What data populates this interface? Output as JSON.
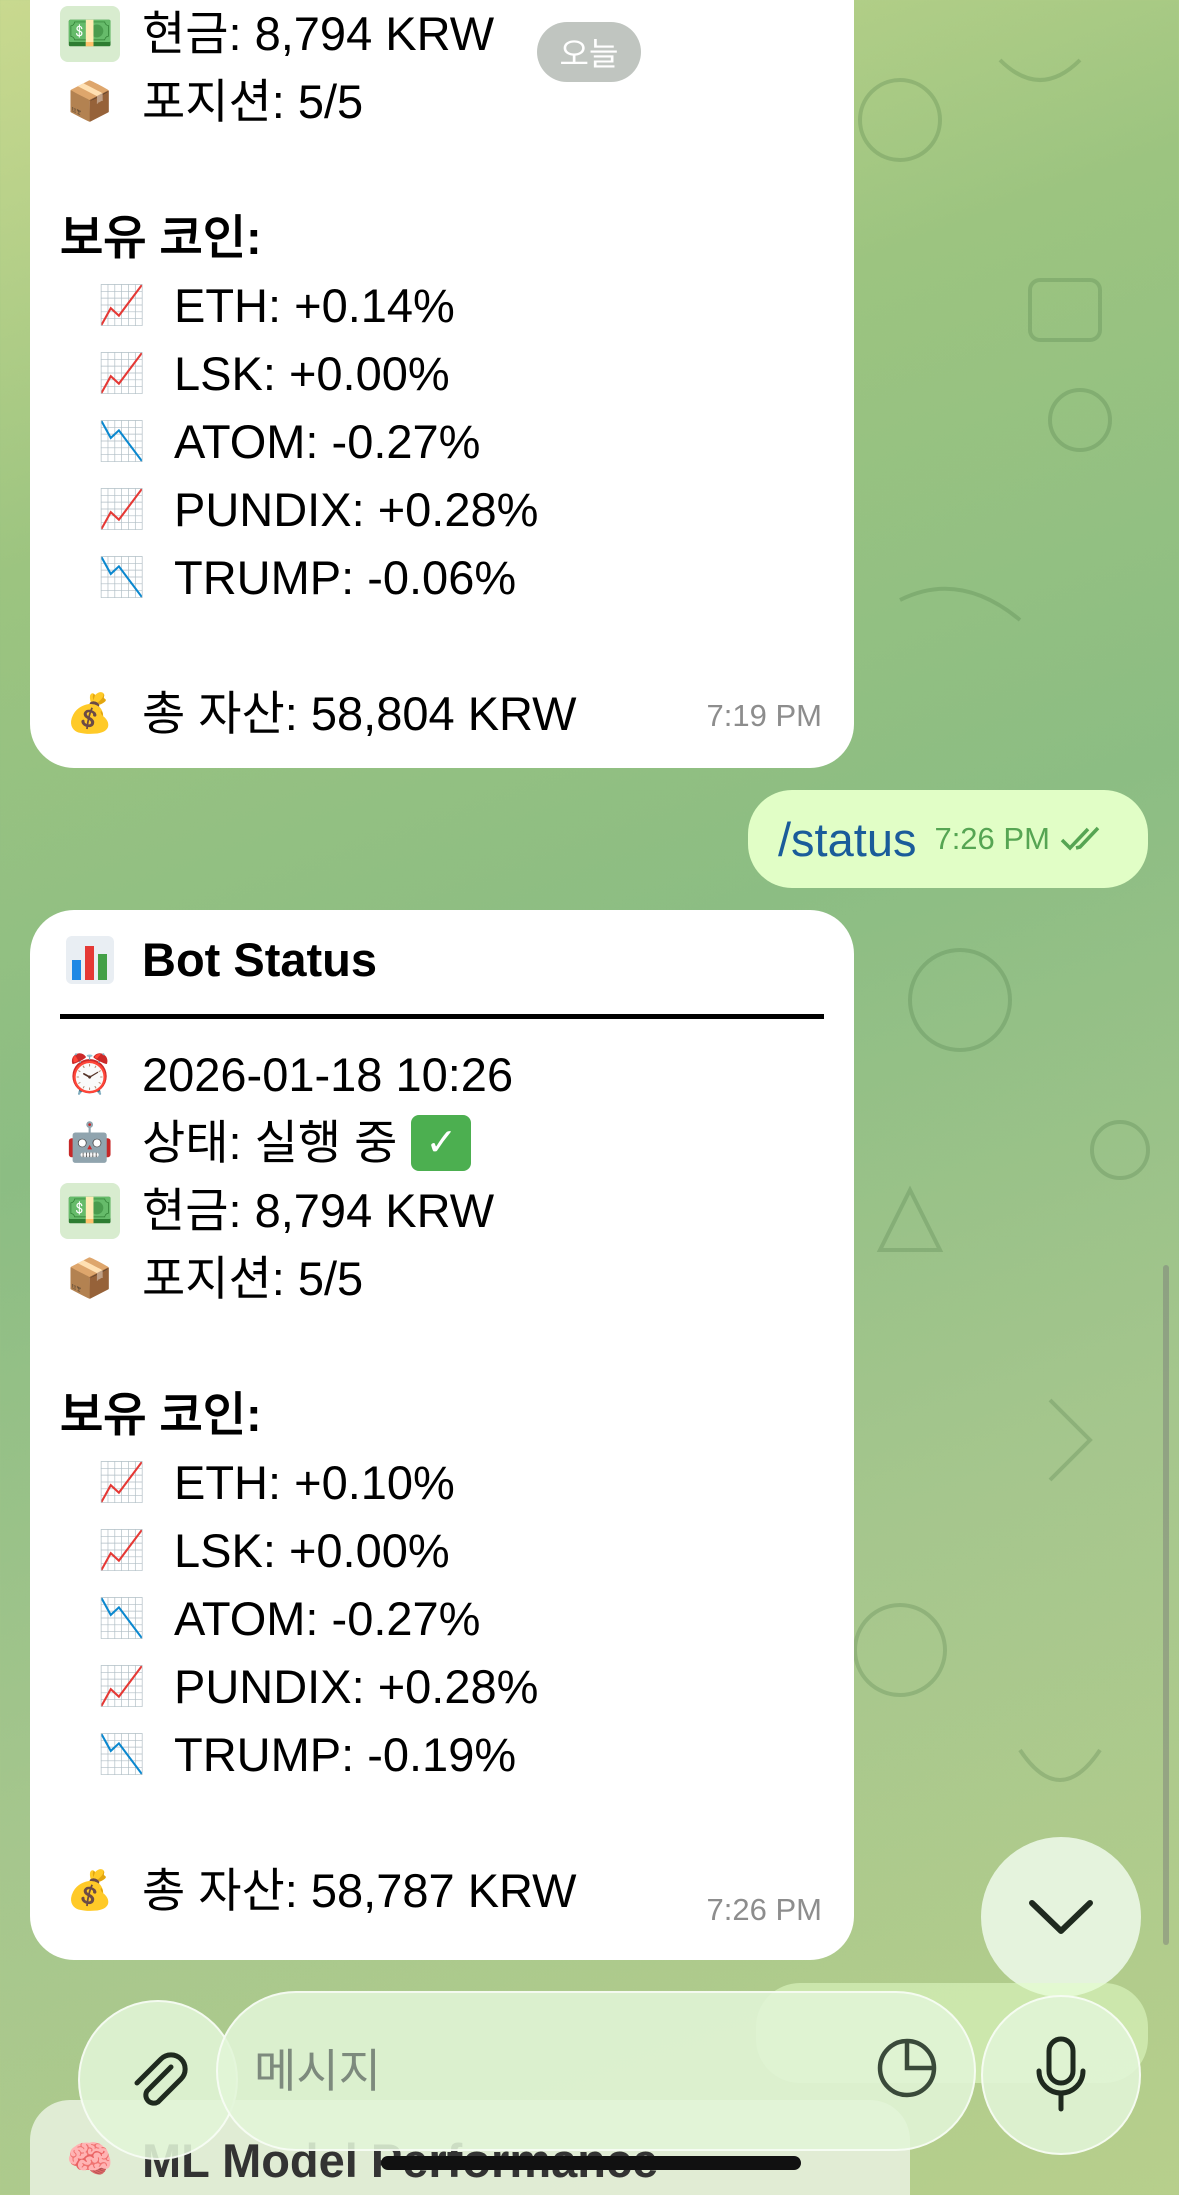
{
  "date_chip": "오늘",
  "previous_status": {
    "cash_label": "현금: 8,794 KRW",
    "position_label": "포지션: 5/5",
    "holdings_header": "보유 코인:",
    "holdings": [
      {
        "text": "ETH: +0.14%",
        "trend": "up"
      },
      {
        "text": "LSK: +0.00%",
        "trend": "up"
      },
      {
        "text": "ATOM: -0.27%",
        "trend": "down"
      },
      {
        "text": "PUNDIX: +0.28%",
        "trend": "up"
      },
      {
        "text": "TRUMP: -0.06%",
        "trend": "down"
      }
    ],
    "total_label": "총 자산: 58,804 KRW",
    "time": "7:19 PM"
  },
  "outgoing": {
    "command": "/status",
    "time": "7:26 PM",
    "read_icon": "double-check-icon"
  },
  "current_status": {
    "title": "Bot Status",
    "timestamp": "2026-01-18 10:26",
    "state_label": "상태: 실행 중",
    "cash_label": "현금: 8,794 KRW",
    "position_label": "포지션: 5/5",
    "holdings_header": "보유 코인:",
    "holdings": [
      {
        "text": "ETH: +0.10%",
        "trend": "up"
      },
      {
        "text": "LSK: +0.00%",
        "trend": "up"
      },
      {
        "text": "ATOM: -0.27%",
        "trend": "down"
      },
      {
        "text": "PUNDIX: +0.28%",
        "trend": "up"
      },
      {
        "text": "TRUMP: -0.19%",
        "trend": "down"
      }
    ],
    "total_label": "총 자산: 58,787 KRW",
    "time": "7:26 PM"
  },
  "composer": {
    "placeholder": "메시지"
  },
  "next_message_preview": "ML Model Performance",
  "icons": {
    "cash": "money-banknote-icon",
    "package": "package-box-icon",
    "chart_up": "chart-increasing-icon",
    "chart_down": "chart-decreasing-icon",
    "money_bag": "money-bag-icon",
    "bar_chart": "bar-chart-icon",
    "alarm": "alarm-clock-icon",
    "robot": "robot-icon",
    "check": "check-mark-button-icon",
    "brain": "brain-icon"
  },
  "colors": {
    "bubble_in": "#ffffff",
    "bubble_out": "#e1fec6",
    "command_link": "#1a5c9a",
    "read_ticks": "#56a553"
  }
}
